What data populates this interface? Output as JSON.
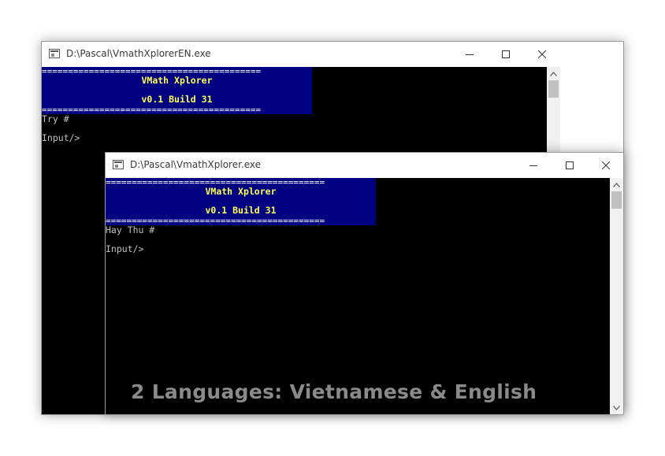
{
  "windows": {
    "back": {
      "title": "D:\\Pascal\\VmathXplorerEN.exe",
      "banner_dashes": "==========================================",
      "banner_title": "VMath Xplorer",
      "banner_version": "v0.1 Build 31",
      "try_line": "Try #",
      "input_prompt": "Input/>"
    },
    "front": {
      "title": "D:\\Pascal\\VmathXplorer.exe",
      "banner_dashes": "==========================================",
      "banner_title": "VMath Xplorer",
      "banner_version": "v0.1 Build 31",
      "try_line": "Hay Thu #",
      "input_prompt": "Input/>"
    }
  },
  "caption": "2 Languages: Vietnamese & English",
  "icons": [
    "console-app-icon",
    "minimize-icon",
    "maximize-icon",
    "close-icon",
    "scroll-up-icon",
    "scroll-down-icon"
  ],
  "colors": {
    "console_bg": "#000000",
    "banner_bg": "#000080",
    "banner_text": "#ffff55",
    "console_text": "#c0c0c0",
    "caption": "#8a8a8a"
  }
}
